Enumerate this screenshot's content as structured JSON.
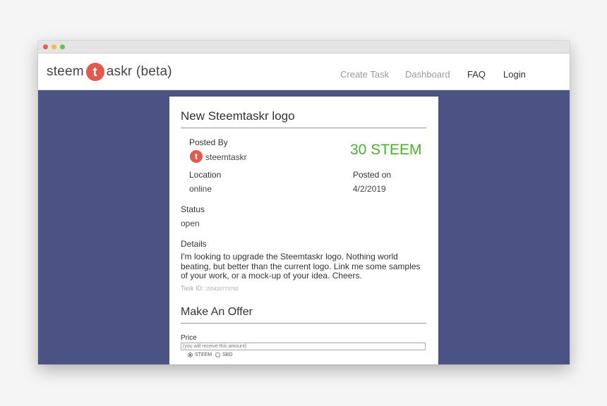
{
  "brand": {
    "prefix": "steem",
    "circle_letter": "t",
    "suffix": "askr (beta)"
  },
  "nav": {
    "create_task": "Create Task",
    "dashboard": "Dashboard",
    "faq": "FAQ",
    "login": "Login"
  },
  "task": {
    "title": "New Steemtaskr logo",
    "posted_by_label": "Posted By",
    "avatar_letter": "t",
    "author": "steemtaskr",
    "reward": "30 STEEM",
    "location_label": "Location",
    "location": "online",
    "posted_on_label": "Posted on",
    "posted_on": "4/2/2019",
    "status_label": "Status",
    "status": "open",
    "details_label": "Details",
    "details": "I'm looking to upgrade the Steemtaskr logo. Nothing world beating, but better than the current logo. Link me some samples of your work, or a mock-up of your idea. Cheers.",
    "task_id_label": "Task ID:",
    "task_id": "155420773792"
  },
  "offer": {
    "title": "Make An Offer",
    "price_label": "Price",
    "price_placeholder": "(you will receive this amount)",
    "currency_options": [
      "STEEM",
      "SBD"
    ],
    "selected_currency": "STEEM"
  },
  "colors": {
    "brand_red": "#e05a4f",
    "reward_green": "#4bae2f",
    "background": "#4a5384"
  }
}
